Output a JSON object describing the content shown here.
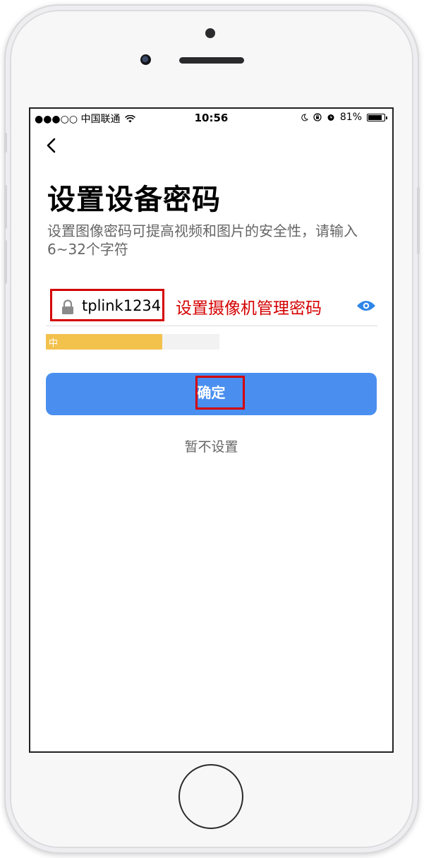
{
  "status_bar": {
    "carrier": "●●●○○ 中国联通",
    "time": "10:56",
    "battery_percent": "81%"
  },
  "header": {
    "title": "设置设备密码",
    "subtitle": "设置图像密码可提高视频和图片的安全性，请输入6~32个字符"
  },
  "password_field": {
    "value": "tplink1234",
    "annotation": "设置摄像机管理密码"
  },
  "strength": {
    "label": "中",
    "level": 0.67
  },
  "actions": {
    "confirm_label": "确定",
    "skip_label": "暂不设置"
  },
  "colors": {
    "primary": "#4a8ff0",
    "highlight": "#d40000",
    "strength_medium": "#f3c24d"
  },
  "icons": [
    "back-arrow-icon",
    "lock-icon",
    "eye-icon",
    "wifi-icon",
    "battery-icon"
  ]
}
